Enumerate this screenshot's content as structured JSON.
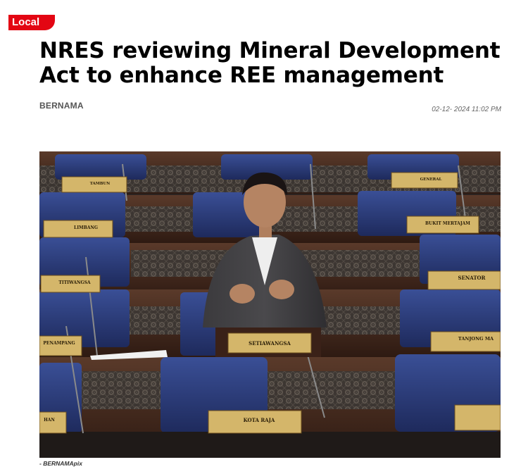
{
  "article": {
    "category": "Local",
    "headline": "NRES reviewing Mineral Development Act to enhance REE management",
    "author": "BERNAMA",
    "timestamp": "02-12- 2024 11:02 PM",
    "photo_caption": "- BERNAMApix"
  },
  "photo": {
    "nameplates": {
      "center": "SETIAWANGSA",
      "bottom_center": "KOTA RAJA",
      "left_mid": "LIMBANG",
      "left_lower": "TITIWANGSA",
      "left_bottom": "PENAMPANG",
      "right_mid": "SENATOR",
      "right_lower": "TANJONG MA",
      "right_top": "BUKIT MERTAJAM",
      "top_left": "TAMBUN",
      "top_right": "GENERAL",
      "bottom_left": "HAN",
      "bottom_right": ""
    }
  },
  "colors": {
    "accent": "#e30613",
    "seat_blue": "#2c3c7a",
    "desk_wood": "#4a2a1e",
    "nameplate_gold": "#c9a95a"
  }
}
